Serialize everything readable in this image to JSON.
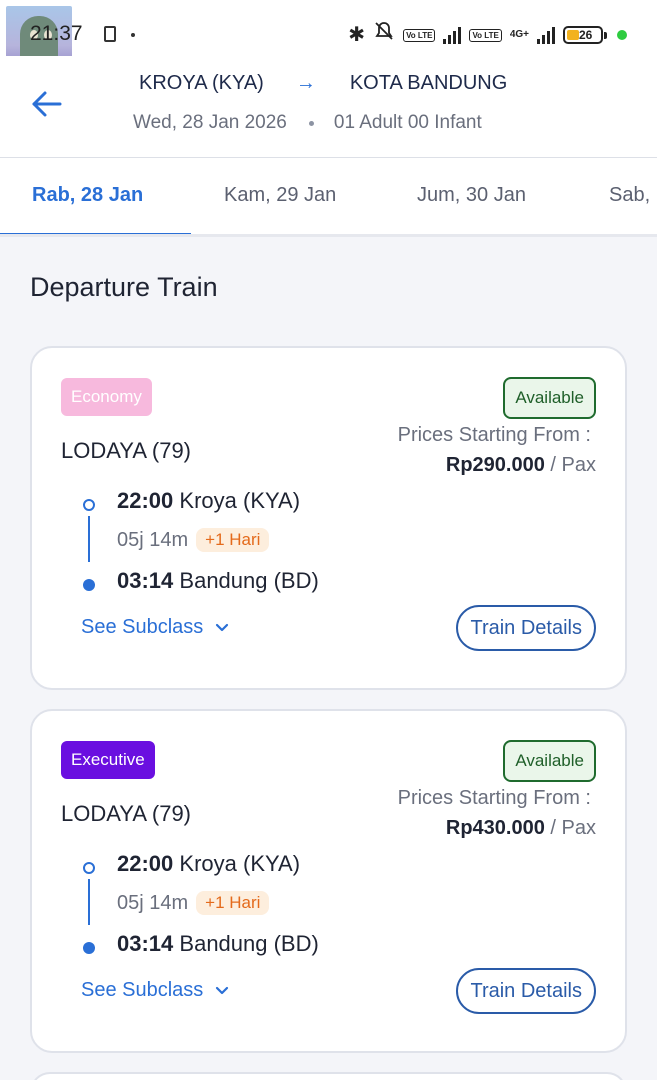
{
  "status_bar": {
    "time": "21:37",
    "battery": "26",
    "network": "4G+",
    "volte_label": "Vo LTE",
    "icons": [
      "bluetooth-icon",
      "mute-bell-icon",
      "volte-icon",
      "signal-icon",
      "battery-icon"
    ]
  },
  "header": {
    "origin": "KROYA (KYA)",
    "destination": "KOTA BANDUNG",
    "date": "Wed, 28 Jan 2026",
    "passengers": "01 Adult 00 Infant"
  },
  "date_tabs": [
    {
      "label": "Rab, 28 Jan",
      "active": true
    },
    {
      "label": "Kam, 29 Jan",
      "active": false
    },
    {
      "label": "Jum, 30 Jan",
      "active": false
    },
    {
      "label": "Sab,",
      "active": false
    }
  ],
  "section_title": "Departure Train",
  "trains": [
    {
      "class": "Economy",
      "class_color": "#f7b9dd",
      "status": "Available",
      "name": "LODAYA (79)",
      "price_label": "Prices Starting From :",
      "price": "Rp290.000",
      "price_unit": "/ Pax",
      "dep_time": "22:00",
      "dep_station": "Kroya (KYA)",
      "duration": "05j 14m",
      "plus_day": "+1 Hari",
      "arr_time": "03:14",
      "arr_station": "Bandung (BD)",
      "subclass_label": "See Subclass",
      "details_label": "Train Details"
    },
    {
      "class": "Executive",
      "class_color": "#6a0fe0",
      "status": "Available",
      "name": "LODAYA (79)",
      "price_label": "Prices Starting From :",
      "price": "Rp430.000",
      "price_unit": "/ Pax",
      "dep_time": "22:00",
      "dep_station": "Kroya (KYA)",
      "duration": "05j 14m",
      "plus_day": "+1 Hari",
      "arr_time": "03:14",
      "arr_station": "Bandung (BD)",
      "subclass_label": "See Subclass",
      "details_label": "Train Details"
    }
  ]
}
